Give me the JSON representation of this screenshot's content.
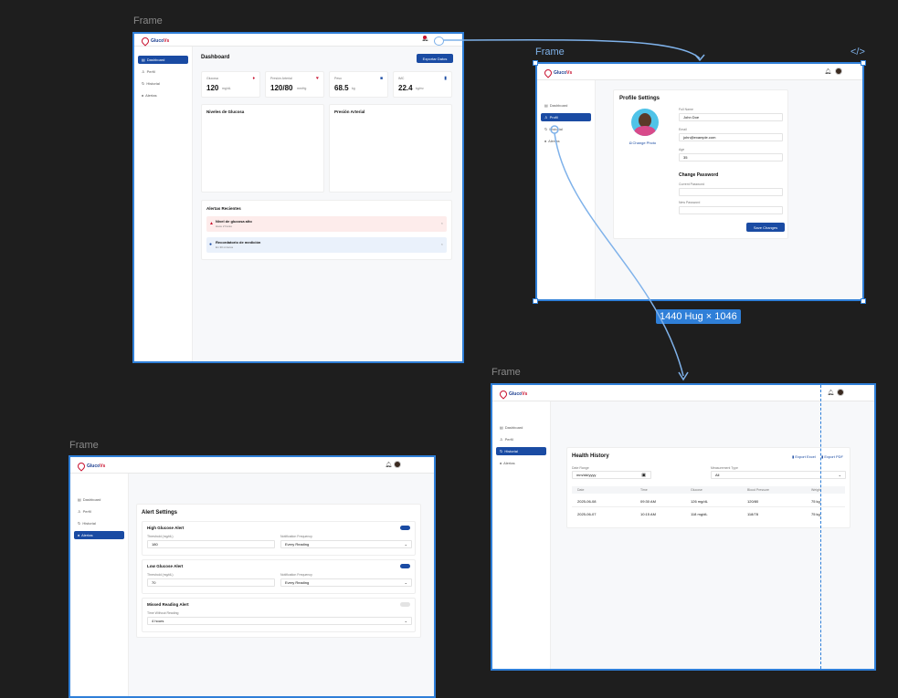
{
  "frames": {
    "label": "Frame"
  },
  "brand": {
    "name_a": "Gluco",
    "name_b": "Vs"
  },
  "nav": {
    "dashboard": "Dashboard",
    "profile": "Perfil",
    "history": "Historial",
    "alerts": "Alertas"
  },
  "nav_en": {
    "dashboard": "Dashboard",
    "profile": "Profil",
    "history": "Historial",
    "alerts": "Alertas"
  },
  "dashboard": {
    "title": "Dashboard",
    "export": "Exportar Datos",
    "stats": [
      {
        "label": "Glucosa",
        "value": "120",
        "unit": "mg/dL"
      },
      {
        "label": "Presión Arterial",
        "value": "120/80",
        "unit": "mmHg"
      },
      {
        "label": "Peso",
        "value": "68.5",
        "unit": "kg"
      },
      {
        "label": "IMC",
        "value": "22.4",
        "unit": "kg/m²"
      }
    ],
    "chart1": "Niveles de Glucosa",
    "chart2": "Presión Arterial",
    "alerts_title": "Alertas Recientes",
    "alert1_title": "Nivel de glucosa alto",
    "alert1_time": "Hace 2 horas",
    "alert2_title": "Recordatorio de medición",
    "alert2_time": "En 30 minutos"
  },
  "profile": {
    "title": "Profile Settings",
    "change_photo": "Change Photo",
    "full_name_label": "Full Name",
    "full_name": "John Doe",
    "email_label": "Email",
    "email": "john@example.com",
    "age_label": "Age",
    "age": "35",
    "pw_title": "Change Password",
    "current_pw": "Current Password",
    "new_pw": "New Password",
    "save": "Save Changes"
  },
  "size_badge": "1440 Hug × 1046",
  "code_icon": "</>",
  "history": {
    "title": "Health History",
    "export_excel": "Export Excel",
    "export_pdf": "Export PDF",
    "date_range_label": "Date Range",
    "date_placeholder": "mm/dd/yyyy",
    "type_label": "Measurement Type",
    "type_value": "All",
    "columns": [
      "Date",
      "Time",
      "Glucose",
      "Blood Pressure",
      "Weight"
    ],
    "rows": [
      [
        "2025-06-08",
        "09:30 AM",
        "126 mg/dL",
        "120/80",
        "75 kg"
      ],
      [
        "2025-06-07",
        "10:15 AM",
        "118 mg/dL",
        "118/78",
        "75 kg"
      ]
    ]
  },
  "alerts_page": {
    "title": "Alert Settings",
    "high_title": "High Glucose Alert",
    "threshold_label": "Threshold (mg/dL)",
    "high_value": "180",
    "freq_label": "Notification Frequency",
    "freq_value": "Every Reading",
    "low_title": "Low Glucose Alert",
    "low_value": "70",
    "missed_title": "Missed Reading Alert",
    "time_label": "Time Without Reading",
    "time_value": "4 hours"
  },
  "colors": {
    "accent": "#1a4ba3",
    "selection": "#2f7fd8",
    "danger": "#c8102e"
  }
}
